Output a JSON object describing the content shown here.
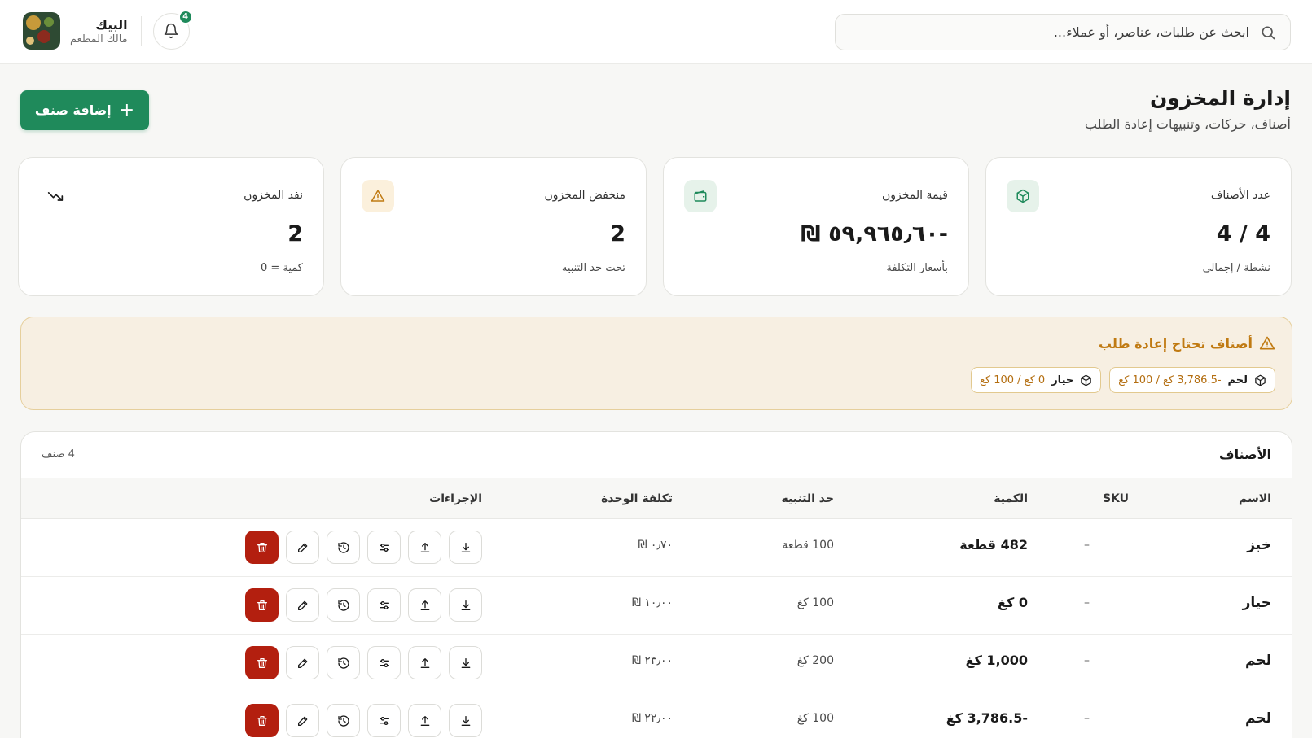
{
  "header": {
    "search_placeholder": "ابحث عن طلبات، عناصر، أو عملاء...",
    "notifications_count": "4",
    "user_name": "البيك",
    "user_role": "مالك المطعم"
  },
  "page": {
    "title": "إدارة المخزون",
    "subtitle": "أصناف، حركات، وتنبيهات إعادة الطلب",
    "add_button": "إضافة صنف"
  },
  "stats": [
    {
      "label": "عدد الأصناف",
      "value": "4 / 4",
      "note": "نشطة / إجمالي",
      "icon": "box-icon",
      "icon_bg": "#e6f2ea",
      "icon_color": "#1f8a5b"
    },
    {
      "label": "قيمة المخزون",
      "value": "-٥٩,٩٦٥٫٦٠ ₪",
      "note": "بأسعار التكلفة",
      "icon": "wallet-icon",
      "icon_bg": "#e6f2ea",
      "icon_color": "#1f8a5b"
    },
    {
      "label": "منخفض المخزون",
      "value": "2",
      "note": "تحت حد التنبيه",
      "icon": "warning-icon",
      "icon_bg": "#fbf0dc",
      "icon_color": "#c07a12"
    },
    {
      "label": "نفد المخزون",
      "value": "2",
      "note": "كمية = 0",
      "icon": "trend-down-icon",
      "icon_bg": "#ffffff",
      "icon_color": "#1a1a1a"
    }
  ],
  "reorder": {
    "title": "أصناف تحتاج إعادة طلب",
    "items": [
      {
        "name": "لحم",
        "qty": "-3,786.5 كغ / 100 كغ"
      },
      {
        "name": "خيار",
        "qty": "0 كغ / 100 كغ"
      }
    ]
  },
  "table": {
    "title": "الأصناف",
    "count": "4 صنف",
    "columns": {
      "name": "الاسم",
      "sku": "SKU",
      "qty": "الكمية",
      "threshold": "حد التنبيه",
      "unit_cost": "تكلفة الوحدة",
      "actions": "الإجراءات"
    },
    "rows": [
      {
        "name": "خبز",
        "sku": "–",
        "qty": "482 قطعة",
        "threshold": "100 قطعة",
        "unit_cost": "٠٫٧٠ ₪"
      },
      {
        "name": "خيار",
        "sku": "–",
        "qty": "0 كغ",
        "threshold": "100 كغ",
        "unit_cost": "١٠٫٠٠ ₪"
      },
      {
        "name": "لحم",
        "sku": "–",
        "qty": "1,000 كغ",
        "threshold": "200 كغ",
        "unit_cost": "٢٣٫٠٠ ₪"
      },
      {
        "name": "لحم",
        "sku": "–",
        "qty": "-3,786.5 كغ",
        "threshold": "100 كغ",
        "unit_cost": "٢٢٫٠٠ ₪"
      }
    ]
  },
  "colors": {
    "primary": "#1f8a5b",
    "danger": "#b31f0f",
    "warning": "#c07a12"
  }
}
